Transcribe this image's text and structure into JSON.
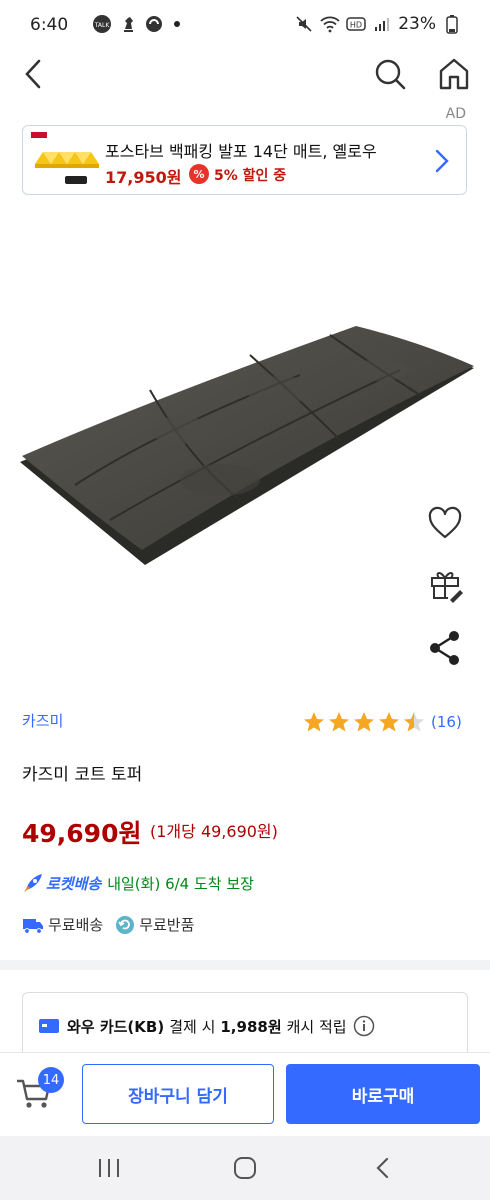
{
  "status_bar": {
    "time": "6:40",
    "battery": "23%"
  },
  "ad": {
    "label": "AD",
    "title": "포스타브 백패킹 발포 14단 매트, 옐로우",
    "price": "17,950원",
    "badge": "%",
    "discount": "5% 할인 중"
  },
  "product": {
    "brand": "카즈미",
    "rating": 4.5,
    "review_count": "(16)",
    "name": "카즈미 코트 토퍼",
    "price": "49,690원",
    "unit_price": "(1개당 49,690원)",
    "delivery_badge": "로켓배송",
    "delivery_text": "내일(화) 6/4 도착 보장",
    "free_shipping": "무료배송",
    "free_return": "무료반품"
  },
  "card_offer": {
    "card_name": "와우 카드(KB)",
    "text1": "결제 시",
    "amount": "1,988원",
    "text2": "캐시 적립"
  },
  "bottom_bar": {
    "cart_count": "14",
    "add_to_cart": "장바구니 담기",
    "buy_now": "바로구매"
  },
  "colors": {
    "accent": "#346aff",
    "price": "#ae0000",
    "delivery": "#00891a",
    "star": "#f5a623"
  }
}
